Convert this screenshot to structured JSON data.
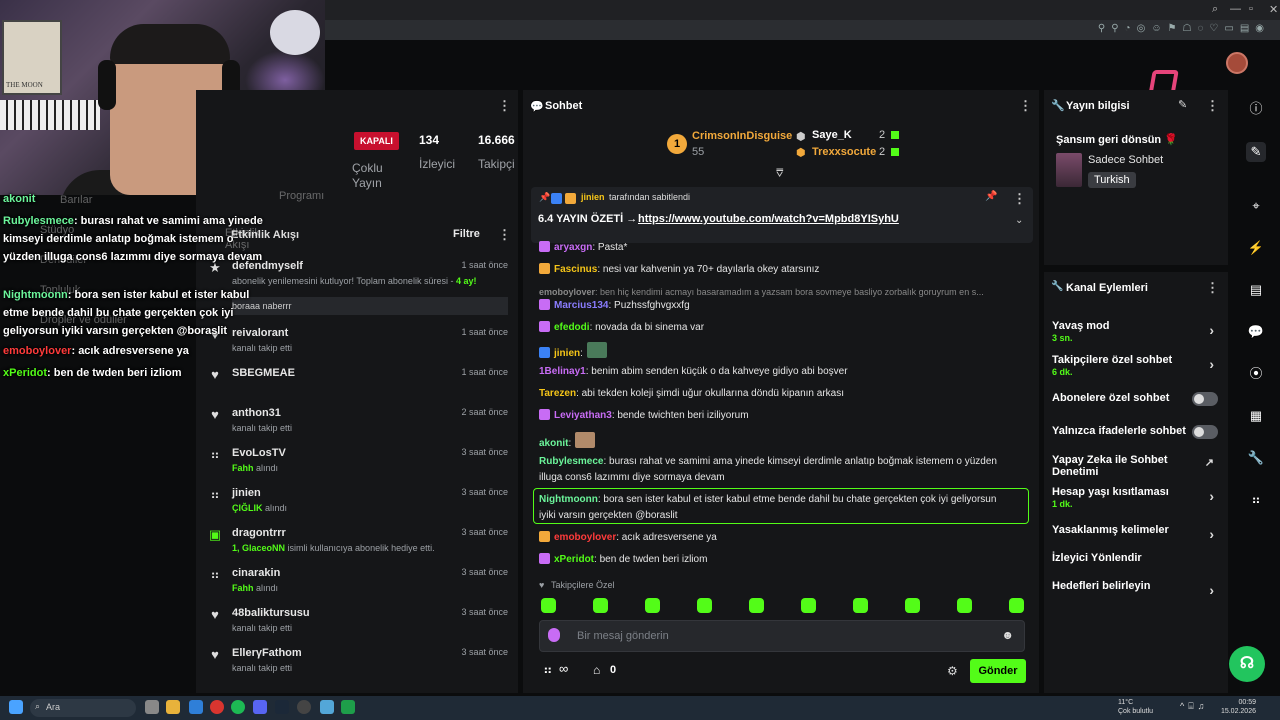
{
  "overlay_chat": {
    "ghost_labels": [
      "Barılar",
      "Stüdyo",
      "Denediler",
      "Topluluk",
      "Dropler ve ödüller",
      "Programı",
      "Etkinlik Akışı"
    ],
    "lines": [
      {
        "user": "akonit",
        "text": "",
        "color": "#6cf59b"
      },
      {
        "user": "Rubylesmece",
        "text": ": burası rahat ve samimi ama yinede kimseyi derdimle anlatıp boğmak istemem o yüzden illuga cons6 lazımmı diye sormaya devam",
        "color": "#6cf59b"
      },
      {
        "user": "Nightmoonn",
        "text": ": bora sen ister kabul et ister kabul etme bende dahil bu chate gerçekten çok iyi geliyorsun iyiki varsın gerçekten @boraslit",
        "color": "#6cf59b"
      },
      {
        "user": "emoboylover",
        "text": ": acık adresversene ya",
        "color": "#ff3b3b"
      },
      {
        "user": "xPeridot",
        "text": ": ben de twden beri izliom",
        "color": "#53fc18"
      }
    ]
  },
  "stats": {
    "status": "KAPALI",
    "status_sub": "Çoklu Yayın",
    "viewers": "134",
    "viewers_label": "İzleyici",
    "followers": "16.666",
    "followers_label": "Takipçi"
  },
  "activity": {
    "title": "Etkinlik Akışı",
    "filter": "Filtre",
    "reply_text": "boraaa naberrr",
    "items": [
      {
        "icon": "star",
        "name": "defendmyself",
        "sub": "abonelik yenilemesini kutluyor! Toplam abonelik süresi - ",
        "sub_hl": "4 ay!",
        "time": "1 saat önce"
      },
      {
        "icon": "heart",
        "name": "reivalorant",
        "sub": "kanalı takip etti",
        "sub_hl": "",
        "time": "1 saat önce"
      },
      {
        "icon": "heart",
        "name": "SBEGMEAE",
        "sub": "",
        "sub_hl": "",
        "time": "1 saat önce"
      },
      {
        "icon": "heart",
        "name": "anthon31",
        "sub": "kanalı takip etti",
        "sub_hl": "",
        "time": "2 saat önce"
      },
      {
        "icon": "dots",
        "name": "EvoLosTV",
        "sub": " alındı",
        "sub_hl": "Fahh",
        "time": "3 saat önce"
      },
      {
        "icon": "dots",
        "name": "jinien",
        "sub": " alındı",
        "sub_hl": "ÇIĞLIK",
        "time": "3 saat önce"
      },
      {
        "icon": "gift",
        "name": "dragontrrr",
        "sub": " isimli kullanıcıya abonelik hediye etti.",
        "sub_hl": "1, GlaceoNN",
        "time": "3 saat önce"
      },
      {
        "icon": "dots",
        "name": "cinarakin",
        "sub": " alındı",
        "sub_hl": "Fahh",
        "time": "3 saat önce"
      },
      {
        "icon": "heart",
        "name": "48baliktursusu",
        "sub": "kanalı takip etti",
        "sub_hl": "",
        "time": "3 saat önce"
      },
      {
        "icon": "heart",
        "name": "EllerγFathom",
        "sub": "kanalı takip etti",
        "sub_hl": "",
        "time": "3 saat önce"
      }
    ]
  },
  "chat": {
    "title": "Sohbet",
    "leaderboard": [
      {
        "rank": "1",
        "name": "CrimsonInDisguise",
        "value": "55",
        "color": "#f2a93b"
      },
      {
        "rank": "",
        "name": "Saye_K",
        "value": "2",
        "color": "#ffffff"
      },
      {
        "rank": "",
        "name": "Trexxsocute",
        "value": "2",
        "color": "#f2a93b"
      }
    ],
    "pinned_by": "jinien",
    "pinned_by_suffix": "tarafından sabitlendi",
    "pinned_text": "6.4 YAYIN ÖZETİ → ",
    "pinned_link": "https://www.youtube.com/watch?v=Mpbd8YISyhU",
    "messages": [
      {
        "user": "aryaxgn",
        "color": "#c86cf5",
        "text": ": Pasta*"
      },
      {
        "user": "Fascinus",
        "color": "#f5c518",
        "text": ": nesi var kahvenin ya 70+ dayılarla okey atarsınız"
      },
      {
        "user": "emoboylover",
        "color": "#888888",
        "text": ": ben hiç kendimi acmayı basaramadım a yazsam bora sovmeye basliyo zorbalık goruyrum en s..."
      },
      {
        "user": "Marcius134",
        "color": "#8a7dff",
        "text": ": Puzhssfghvgxxfg"
      },
      {
        "user": "efedodi",
        "color": "#53fc18",
        "text": ": novada da bi sinema var"
      },
      {
        "user": "jinien",
        "color": "#f5c518",
        "text": ":"
      },
      {
        "user": "1Belinay1",
        "color": "#c86cf5",
        "text": ": benim abim senden küçük o da kahveye gidiyo abi boşver"
      },
      {
        "user": "Tarezen",
        "color": "#f5c518",
        "text": ": abi tekden koleji şimdi uğur okullarına döndü kipanın arkası"
      },
      {
        "user": "Leviyathan3",
        "color": "#c86cf5",
        "text": ": bende twichten beri iziliyorum"
      },
      {
        "user": "akonit",
        "color": "#6cf59b",
        "text": ":"
      },
      {
        "user": "Rubylesmece",
        "color": "#6cf59b",
        "text": ": burası rahat ve samimi ama yinede kimseyi derdimle anlatıp boğmak istemem o yüzden"
      },
      {
        "user": "",
        "color": "#e6e6e6",
        "text": "illuga cons6 lazımmı diye sormaya devam"
      },
      {
        "user": "Nightmoonn",
        "color": "#6cf59b",
        "text": ": bora sen ister kabul et ister kabul etme bende dahil bu chate gerçekten çok iyi geliyorsun"
      },
      {
        "user": "",
        "color": "#e6e6e6",
        "text": "iyiki varsın gerçekten @boraslit"
      },
      {
        "user": "emoboylover",
        "color": "#ff3b3b",
        "text": ": acık adresversene ya"
      },
      {
        "user": "xPeridot",
        "color": "#53fc18",
        "text": ": ben de twden beri izliom"
      }
    ],
    "followers_only": "Takipçilere Özel",
    "input_placeholder": "Bir mesaj gönderin",
    "infinity": "∞",
    "gift_count": "0",
    "send_label": "Gönder"
  },
  "stream_info": {
    "title": "Yayın bilgisi",
    "stream_title": "Şansım geri dönsün 🌹",
    "category": "Sadece Sohbet",
    "language": "Turkish"
  },
  "channel_actions": {
    "title": "Kanal Eylemleri",
    "items": [
      {
        "label": "Yavaş mod",
        "sub": "3 sn.",
        "control": "chevron"
      },
      {
        "label": "Takipçilere özel sohbet",
        "sub": "6 dk.",
        "control": "chevron"
      },
      {
        "label": "Abonelere özel sohbet",
        "sub": "",
        "control": "toggle"
      },
      {
        "label": "Yalnızca ifadelerle sohbet",
        "sub": "",
        "control": "toggle"
      },
      {
        "label": "Yapay Zeka ile Sohbet Denetimi",
        "sub": "",
        "control": "external"
      },
      {
        "label": "Hesap yaşı kısıtlaması",
        "sub": "1 dk.",
        "control": "chevron"
      },
      {
        "label": "Yasaklanmış kelimeler",
        "sub": "",
        "control": "chevron"
      },
      {
        "label": "İzleyici Yönlendir",
        "sub": "",
        "control": "none"
      },
      {
        "label": "Hedefleri belirleyin",
        "sub": "",
        "control": "chevron"
      }
    ]
  },
  "taskbar": {
    "search": "Ara",
    "weather_temp": "11°C",
    "weather_desc": "Çok bulutlu",
    "time": "00:59",
    "date": "15.02.2026"
  },
  "webcam": {
    "poster_text": "THE MOON"
  },
  "colors": {
    "accent": "#53fc18",
    "live_badge": "#c8102e",
    "panel": "#151618"
  }
}
